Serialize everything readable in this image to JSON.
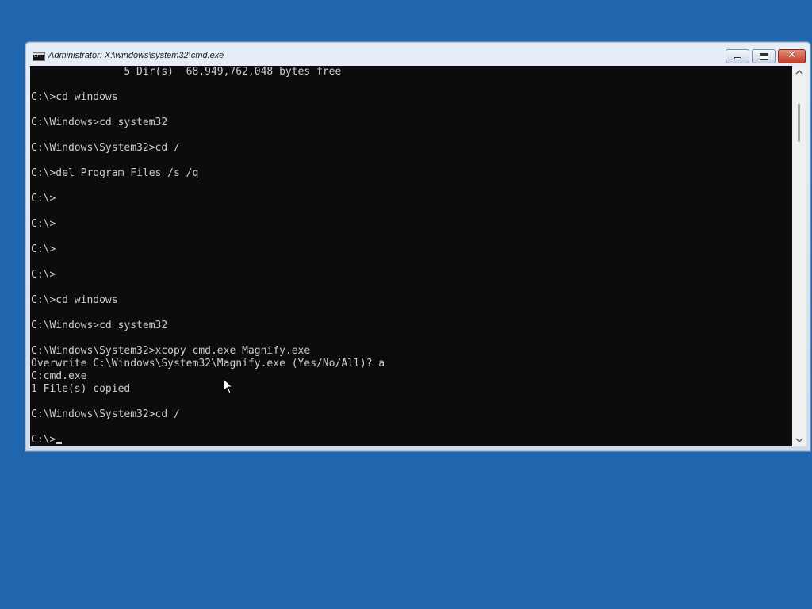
{
  "window": {
    "title": "Administrator: X:\\windows\\system32\\cmd.exe"
  },
  "console": {
    "lines": [
      "               5 Dir(s)  68,949,762,048 bytes free",
      "",
      "C:\\>cd windows",
      "",
      "C:\\Windows>cd system32",
      "",
      "C:\\Windows\\System32>cd /",
      "",
      "C:\\>del Program Files /s /q",
      "",
      "C:\\>",
      "",
      "C:\\>",
      "",
      "C:\\>",
      "",
      "C:\\>",
      "",
      "C:\\>cd windows",
      "",
      "C:\\Windows>cd system32",
      "",
      "C:\\Windows\\System32>xcopy cmd.exe Magnify.exe",
      "Overwrite C:\\Windows\\System32\\Magnify.exe (Yes/No/All)? a",
      "C:cmd.exe",
      "1 File(s) copied",
      "",
      "C:\\Windows\\System32>cd /",
      ""
    ],
    "prompt": "C:\\>"
  },
  "colors": {
    "desktop": "#1f66ae",
    "console_bg": "#0c0c0c",
    "console_text": "#cccccc"
  },
  "icons": {
    "app": "cmd-icon",
    "minimize": "minimize-icon",
    "maximize": "maximize-icon",
    "close": "close-icon",
    "pointer": "mouse-pointer-icon"
  }
}
